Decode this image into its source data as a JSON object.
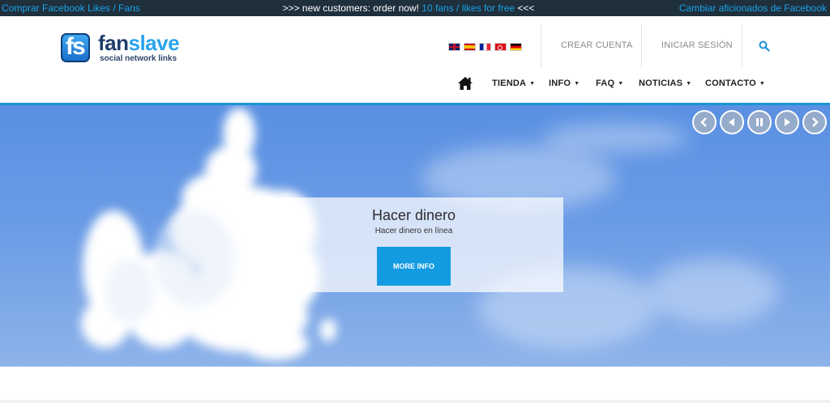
{
  "topbar": {
    "left_link": "Comprar Facebook Likes / Fans",
    "promo_prefix": ">>> new customers: order now!",
    "promo_highlight": "10 fans / likes for free",
    "promo_suffix": "<<<",
    "right_link": "Cambiar aficionados de Facebook"
  },
  "logo": {
    "mark": "fs",
    "name_part1": "fan",
    "name_part2": "slave",
    "tagline": "social network links"
  },
  "languages": [
    "uk-flag",
    "es-flag",
    "fr-flag",
    "tr-flag",
    "de-flag"
  ],
  "header": {
    "create_account": "CREAR CUENTA",
    "login": "INICIAR SESIÓN",
    "search_icon": "search-icon"
  },
  "nav": {
    "home_icon": "home-icon",
    "items": [
      {
        "label": "TIENDA"
      },
      {
        "label": "INFO"
      },
      {
        "label": "FAQ"
      },
      {
        "label": "NOTICIAS"
      },
      {
        "label": "CONTACTO"
      }
    ]
  },
  "slider": {
    "controls": [
      "first-icon",
      "prev-icon",
      "pause-icon",
      "next-icon",
      "last-icon"
    ],
    "caption_title": "Hacer dinero",
    "caption_subtitle": "Hacer dinero en línea",
    "button_label": "MORE INFO"
  },
  "colors": {
    "accent": "#139be2",
    "topbar_bg": "#1f2f3c",
    "link": "#1aa3e8"
  }
}
